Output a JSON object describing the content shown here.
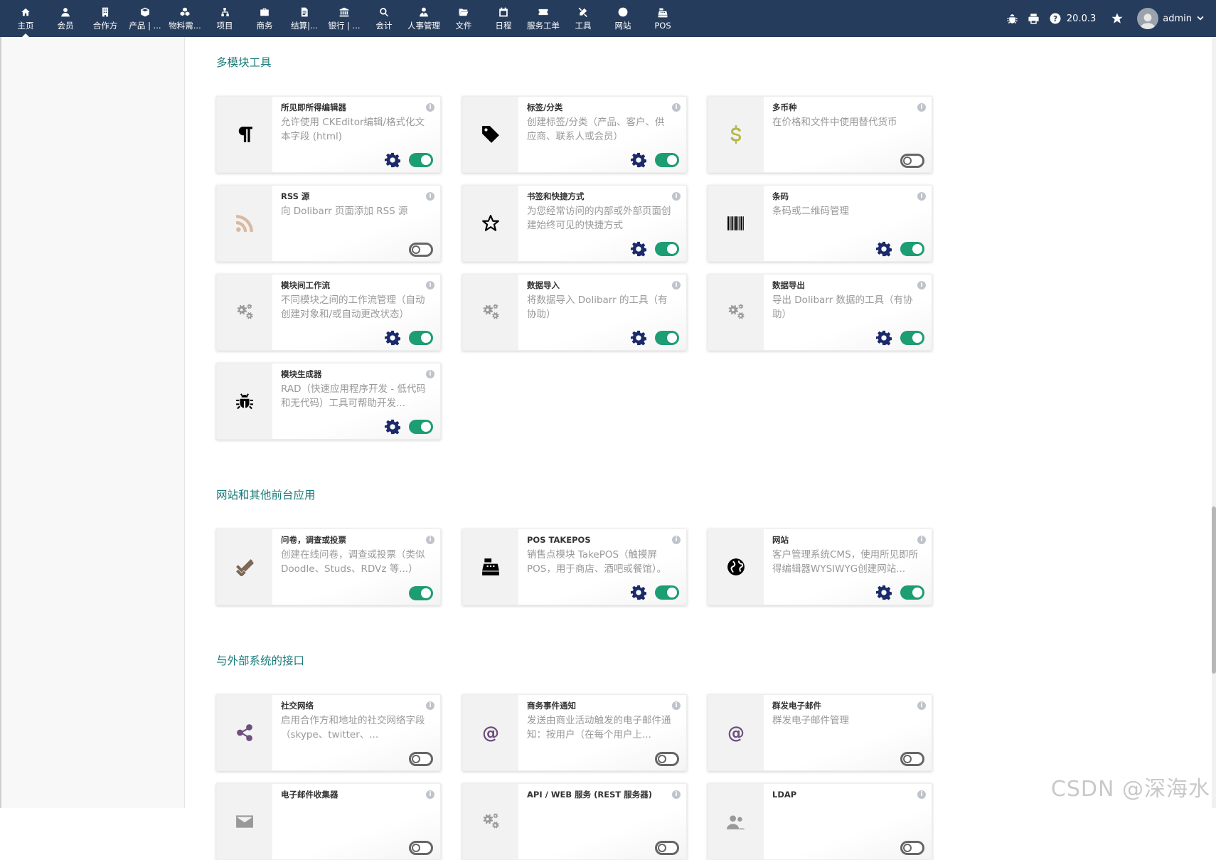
{
  "topbar": {
    "menu": [
      {
        "label": "主页",
        "icon": "home-icon",
        "active": true
      },
      {
        "label": "会员",
        "icon": "user-icon"
      },
      {
        "label": "合作方",
        "icon": "building-icon"
      },
      {
        "label": "产品 | ...",
        "icon": "cube-icon"
      },
      {
        "label": "物料需...",
        "icon": "cubes-icon"
      },
      {
        "label": "项目",
        "icon": "sitemap-icon"
      },
      {
        "label": "商务",
        "icon": "briefcase-icon"
      },
      {
        "label": "结算|...",
        "icon": "file-invoice-icon"
      },
      {
        "label": "银行 | ...",
        "icon": "bank-icon"
      },
      {
        "label": "会计",
        "icon": "search-dollar-icon"
      },
      {
        "label": "人事管理",
        "icon": "user-tie-icon"
      },
      {
        "label": "文件",
        "icon": "folder-open-icon"
      },
      {
        "label": "日程",
        "icon": "calendar-icon"
      },
      {
        "label": "服务工单",
        "icon": "ticket-icon"
      },
      {
        "label": "工具",
        "icon": "tools-icon"
      },
      {
        "label": "网站",
        "icon": "globe-icon"
      },
      {
        "label": "POS",
        "icon": "cash-register-icon"
      }
    ],
    "version": "20.0.3",
    "user": "admin"
  },
  "sections": [
    {
      "title": "多模块工具",
      "cards": [
        {
          "name": "所见即所得编辑器",
          "desc": "允许使用 CKEditor编辑/格式化文本字段 (html)",
          "icon": "paragraph-icon",
          "on": true,
          "gear": true
        },
        {
          "name": "标签/分类",
          "desc": "创建标签/分类（产品、客户、供应商、联系人或会员）",
          "icon": "tag-icon",
          "on": true,
          "gear": true
        },
        {
          "name": "多币种",
          "desc": "在价格和文件中使用替代货币",
          "icon": "dollar-icon",
          "on": false,
          "gear": false
        },
        {
          "name": "RSS 源",
          "desc": "向 Dolibarr 页面添加 RSS 源",
          "icon": "rss-icon",
          "on": false,
          "gear": false
        },
        {
          "name": "书签和快捷方式",
          "desc": "为您经常访问的内部或外部页面创建始终可见的快捷方式",
          "icon": "star-icon",
          "on": true,
          "gear": true
        },
        {
          "name": "条码",
          "desc": "条码或二维码管理",
          "icon": "barcode-icon",
          "on": true,
          "gear": true
        },
        {
          "name": "模块间工作流",
          "desc": "不同模块之间的工作流管理（自动创建对象和/或自动更改状态）",
          "icon": "cogs-icon",
          "on": true,
          "gear": true
        },
        {
          "name": "数据导入",
          "desc": "将数据导入 Dolibarr 的工具（有协助）",
          "icon": "cogs-icon",
          "on": true,
          "gear": true
        },
        {
          "name": "数据导出",
          "desc": "导出 Dolibarr 数据的工具（有协助）",
          "icon": "cogs-icon",
          "on": true,
          "gear": true
        },
        {
          "name": "模块生成器",
          "desc": "RAD（快速应用程序开发 - 低代码和无代码）工具可帮助开发...",
          "icon": "bug-icon",
          "on": true,
          "gear": true
        }
      ]
    },
    {
      "title": "网站和其他前台应用",
      "cards": [
        {
          "name": "问卷，调查或投票",
          "desc": "创建在线问卷，调查或投票（类似 Doodle、Studs、RDVz 等...）",
          "icon": "check-double-icon",
          "on": true,
          "gear": false
        },
        {
          "name": "POS TAKEPOS",
          "desc": "销售点模块 TakePOS（触摸屏POS，用于商店、酒吧或餐馆）。",
          "icon": "cash-register-icon",
          "on": true,
          "gear": true
        },
        {
          "name": "网站",
          "desc": "客户管理系统CMS，使用所见即所得编辑器WYSIWYG创建网站...",
          "icon": "globe-icon",
          "on": true,
          "gear": true
        }
      ]
    },
    {
      "title": "与外部系统的接口",
      "cards": [
        {
          "name": "社交网络",
          "desc": "启用合作方和地址的社交网络字段（skype、twitter、...",
          "icon": "share-alt-icon",
          "on": false,
          "gear": false
        },
        {
          "name": "商务事件通知",
          "desc": "发送由商业活动触发的电子邮件通知：按用户（在每个用户上...",
          "icon": "at-icon",
          "on": false,
          "gear": false
        },
        {
          "name": "群发电子邮件",
          "desc": "群发电子邮件管理",
          "icon": "at-icon",
          "on": false,
          "gear": false
        },
        {
          "name": "电子邮件收集器",
          "desc": "",
          "icon": "envelope-icon",
          "on": false,
          "gear": false
        },
        {
          "name": "API / WEB 服务 (REST 服务器)",
          "desc": "",
          "icon": "cogs-icon",
          "on": false,
          "gear": false
        },
        {
          "name": "LDAP",
          "desc": "",
          "icon": "users-icon",
          "on": false,
          "gear": false
        }
      ]
    }
  ],
  "colors": {
    "topbar": "#263c5c",
    "section_title": "#1a7a7a",
    "toggle_on": "#1d9d73",
    "gear": "#1b2a6b",
    "icon_dollar": "#b5b84a",
    "icon_rss": "#d9b9a0",
    "icon_check": "#7a6652",
    "icon_pos": "#b8c44a",
    "icon_globe": "#3c1f4f",
    "icon_share": "#6c4f7c",
    "icon_at": "#6c4f7c"
  },
  "watermark": "CSDN @深海水"
}
